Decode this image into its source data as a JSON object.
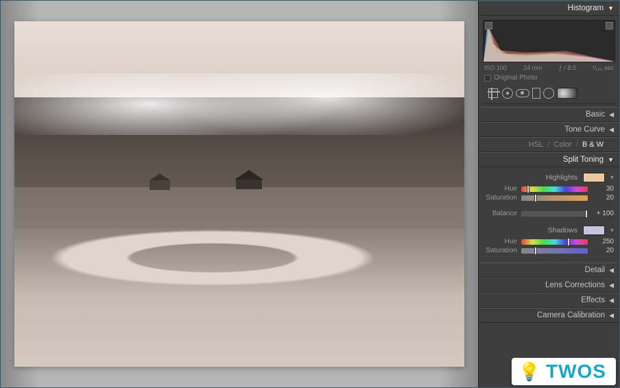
{
  "panels": {
    "histogram": "Histogram",
    "basic": "Basic",
    "tone_curve": "Tone Curve",
    "split_toning": "Split Toning",
    "detail": "Detail",
    "lens_corrections": "Lens Corrections",
    "effects": "Effects",
    "camera_calibration": "Camera Calibration"
  },
  "hsl": {
    "hsl": "HSL",
    "color": "Color",
    "bw": "B & W",
    "sep": "/"
  },
  "histogram_meta": {
    "iso": "ISO 100",
    "focal": "24 mm",
    "aperture": "ƒ / 8.0",
    "shutter": "¹⁄₁₂₅ sec"
  },
  "original_photo": "Original Photo",
  "split": {
    "highlights_label": "Highlights",
    "shadows_label": "Shadows",
    "hue_label": "Hue",
    "saturation_label": "Saturation",
    "balance_label": "Balance",
    "highlights": {
      "hue": 30,
      "saturation": 20,
      "swatch": "#e8c9a0"
    },
    "balance": "+ 100",
    "shadows": {
      "hue": 250,
      "saturation": 20,
      "swatch": "#c9c3e0"
    }
  },
  "watermark": {
    "icon": "💡",
    "text": "TWOS"
  }
}
